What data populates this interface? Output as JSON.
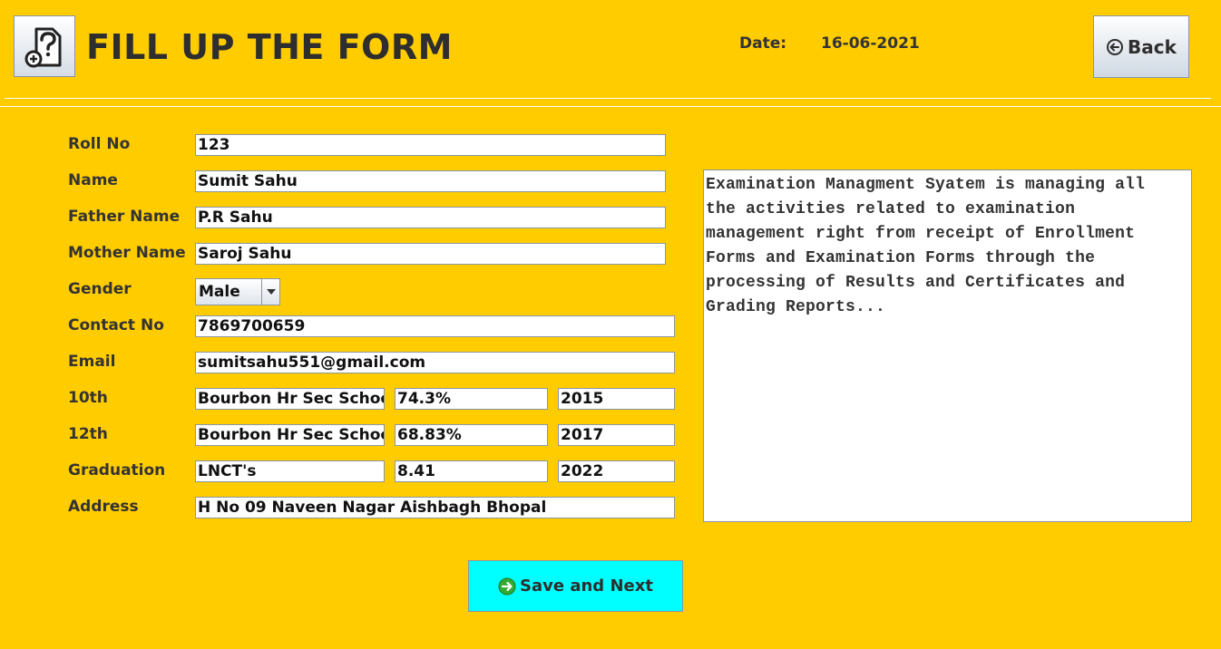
{
  "header": {
    "title": "FILL UP THE FORM",
    "date_label": "Date:",
    "date_value": "16-06-2021",
    "back_label": "Back",
    "logo_icon": "form-question-icon"
  },
  "form": {
    "labels": {
      "roll_no": "Roll No",
      "name": "Name",
      "father_name": "Father Name",
      "mother_name": "Mother Name",
      "gender": "Gender",
      "contact_no": "Contact No",
      "email": "Email",
      "tenth": "10th",
      "twelfth": "12th",
      "graduation": "Graduation",
      "address": "Address"
    },
    "values": {
      "roll_no": "123",
      "name": "Sumit Sahu",
      "father_name": "P.R Sahu",
      "mother_name": "Saroj Sahu",
      "gender": "Male",
      "contact_no": "7869700659",
      "email": "sumitsahu551@gmail.com",
      "tenth": {
        "school": "Bourbon Hr Sec School",
        "score": "74.3%",
        "year": "2015"
      },
      "twelfth": {
        "school": "Bourbon Hr Sec School",
        "score": "68.83%",
        "year": "2017"
      },
      "graduation": {
        "school": "LNCT's",
        "score": "8.41",
        "year": "2022"
      },
      "address": "H No 09 Naveen Nagar Aishbagh Bhopal"
    }
  },
  "info_text": "Examination Managment Syatem is managing all\nthe activities related to examination\nmanagement right from receipt of Enrollment\nForms and Examination Forms through the\nprocessing of Results and Certificates and\nGrading Reports...",
  "save_button": {
    "label": "Save and Next",
    "icon": "arrow-right-circle-icon"
  },
  "colors": {
    "background": "#FFCC00",
    "save_button": "#00FFFF",
    "save_icon": "#33AA33"
  }
}
